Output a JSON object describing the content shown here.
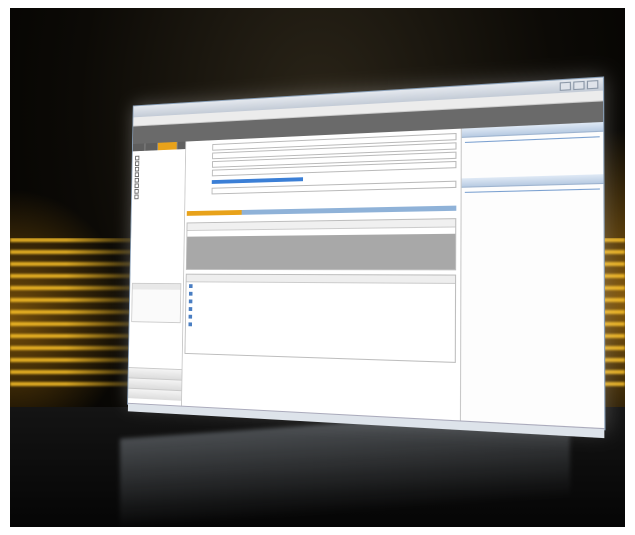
{
  "scene": {
    "accent_color": "#e8a21a",
    "selection_color": "#3b7fd6"
  },
  "window": {
    "title": "",
    "menu": [
      "",
      "",
      "",
      "",
      ""
    ],
    "left_panel": {
      "tree_items": [
        "",
        "",
        "",
        "",
        "",
        "",
        "",
        ""
      ],
      "nav_items": [
        "",
        "",
        ""
      ]
    },
    "center": {
      "form_labels": [
        "",
        "",
        "",
        "",
        "",
        ""
      ],
      "list_rows": [
        "",
        "",
        "",
        "",
        "",
        ""
      ]
    },
    "right_panel": {
      "panes": [
        "",
        ""
      ]
    }
  }
}
